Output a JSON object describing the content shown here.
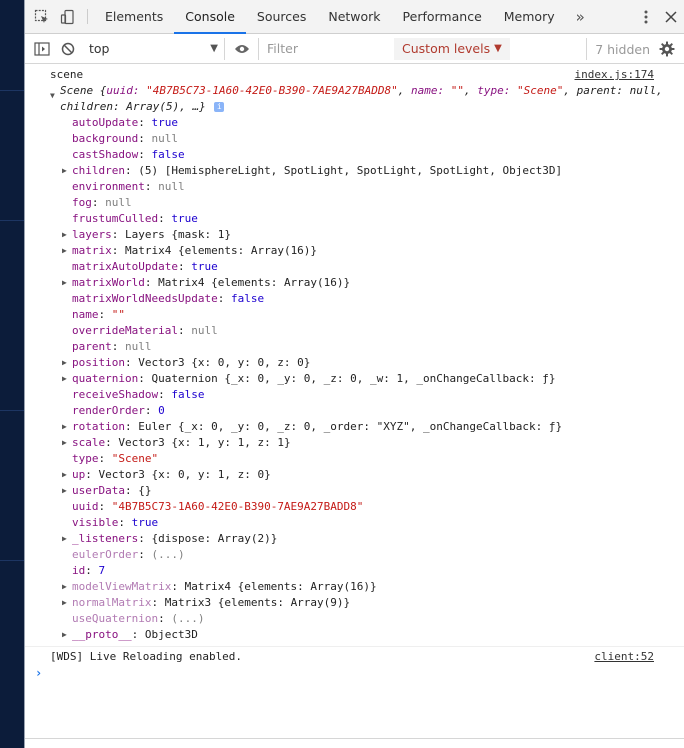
{
  "tabs": [
    {
      "label": "Elements"
    },
    {
      "label": "Console"
    },
    {
      "label": "Sources"
    },
    {
      "label": "Network"
    },
    {
      "label": "Performance"
    },
    {
      "label": "Memory"
    }
  ],
  "more_tabs": "»",
  "toolbar": {
    "context": "top",
    "filter_placeholder": "Filter",
    "levels": "Custom levels",
    "hidden": "7 hidden"
  },
  "log": {
    "label": "scene",
    "source": "index.js:174",
    "preview": {
      "class": "Scene",
      "uuid_key": "uuid:",
      "uuid_val": "\"4B7B5C73-1A60-42E0-B390-7AE9A27BADD8\"",
      "name_key": "name:",
      "name_val": "\"\"",
      "type_key": "type:",
      "type_val": "\"Scene\"",
      "parent": "parent: null,",
      "children": "children: Array(5), …}"
    },
    "props": [
      {
        "key": "autoUpdate",
        "value": "true"
      },
      {
        "key": "background",
        "value": "null"
      },
      {
        "key": "castShadow",
        "value": "false"
      },
      {
        "key": "children",
        "value": "(5) [HemisphereLight, SpotLight, SpotLight, SpotLight, Object3D]"
      },
      {
        "key": "environment",
        "value": "null"
      },
      {
        "key": "fog",
        "value": "null"
      },
      {
        "key": "frustumCulled",
        "value": "true"
      },
      {
        "key": "layers",
        "value": "Layers {mask: 1}"
      },
      {
        "key": "matrix",
        "value": "Matrix4 {elements: Array(16)}"
      },
      {
        "key": "matrixAutoUpdate",
        "value": "true"
      },
      {
        "key": "matrixWorld",
        "value": "Matrix4 {elements: Array(16)}"
      },
      {
        "key": "matrixWorldNeedsUpdate",
        "value": "false"
      },
      {
        "key": "name",
        "value": "\"\""
      },
      {
        "key": "overrideMaterial",
        "value": "null"
      },
      {
        "key": "parent",
        "value": "null"
      },
      {
        "key": "position",
        "value": "Vector3 {x: 0, y: 0, z: 0}"
      },
      {
        "key": "quaternion",
        "value": "Quaternion {_x: 0, _y: 0, _z: 0, _w: 1, _onChangeCallback: ƒ}"
      },
      {
        "key": "receiveShadow",
        "value": "false"
      },
      {
        "key": "renderOrder",
        "value": "0"
      },
      {
        "key": "rotation",
        "value": "Euler {_x: 0, _y: 0, _z: 0, _order: \"XYZ\", _onChangeCallback: ƒ}"
      },
      {
        "key": "scale",
        "value": "Vector3 {x: 1, y: 1, z: 1}"
      },
      {
        "key": "type",
        "value": "\"Scene\""
      },
      {
        "key": "up",
        "value": "Vector3 {x: 0, y: 1, z: 0}"
      },
      {
        "key": "userData",
        "value": "{}"
      },
      {
        "key": "uuid",
        "value": "\"4B7B5C73-1A60-42E0-B390-7AE9A27BADD8\""
      },
      {
        "key": "visible",
        "value": "true"
      },
      {
        "key": "_listeners",
        "value": "{dispose: Array(2)}"
      },
      {
        "key": "eulerOrder",
        "value": "(...)"
      },
      {
        "key": "id",
        "value": "7"
      },
      {
        "key": "modelViewMatrix",
        "value": "Matrix4 {elements: Array(16)}"
      },
      {
        "key": "normalMatrix",
        "value": "Matrix3 {elements: Array(9)}"
      },
      {
        "key": "useQuaternion",
        "value": "(...)"
      },
      {
        "key": "__proto__",
        "value": "Object3D"
      }
    ]
  },
  "wds": {
    "text": "[WDS] Live Reloading enabled.",
    "source": "client:52"
  },
  "prompt_symbol": "›",
  "colors": {
    "accent": "#1a73e8",
    "key": "#881280",
    "string": "#c41a16",
    "number": "#1c00cf",
    "levels": "#b03a2e"
  }
}
